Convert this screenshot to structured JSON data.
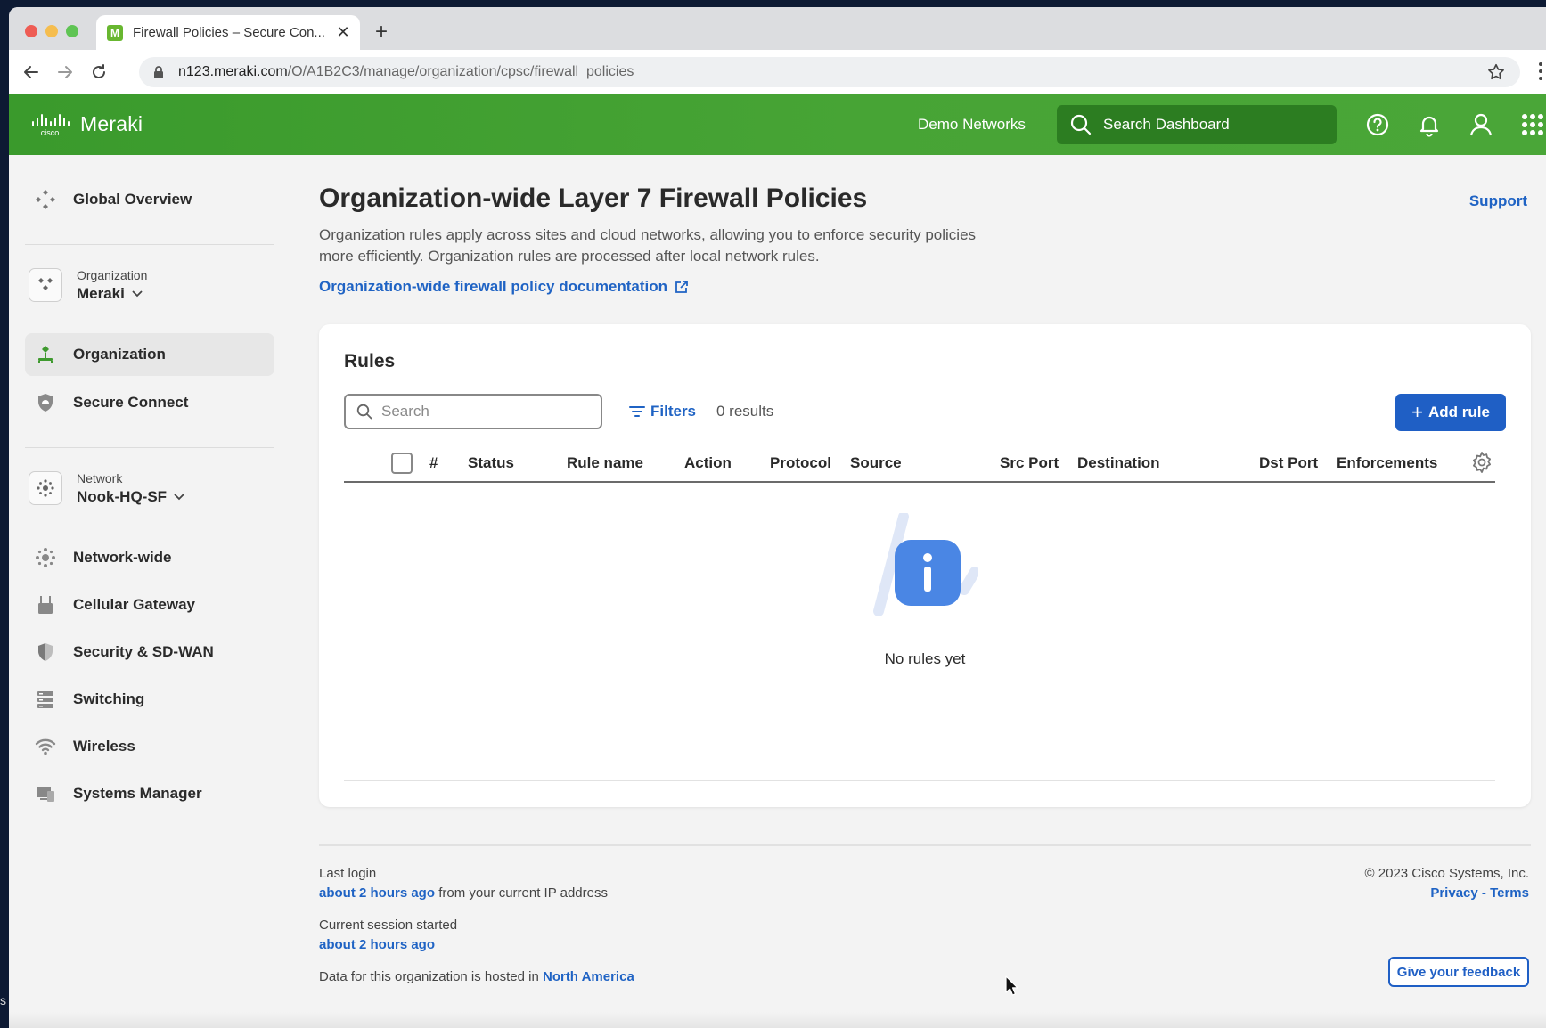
{
  "browser": {
    "tab_title": "Firewall Policies – Secure Con...",
    "favicon_letter": "M",
    "url_host": "n123.meraki.com",
    "url_path": "/O/A1B2C3/manage/organization/cpsc/firewall_policies"
  },
  "header": {
    "logo_text": "Meraki",
    "logo_small": "cisco",
    "demo_networks": "Demo Networks",
    "search_placeholder": "Search Dashboard",
    "brand_color": "#43a133"
  },
  "sidebar": {
    "global_overview": "Global Overview",
    "org_context": {
      "label": "Organization",
      "value": "Meraki"
    },
    "org_items": [
      {
        "label": "Organization",
        "icon": "organization-icon",
        "active": true
      },
      {
        "label": "Secure Connect",
        "icon": "shield-icon",
        "active": false
      }
    ],
    "network_context": {
      "label": "Network",
      "value": "Nook-HQ-SF"
    },
    "network_items": [
      {
        "label": "Network-wide",
        "icon": "network-wide-icon"
      },
      {
        "label": "Cellular Gateway",
        "icon": "cellular-gateway-icon"
      },
      {
        "label": "Security & SD-WAN",
        "icon": "security-sdwan-icon"
      },
      {
        "label": "Switching",
        "icon": "switching-icon"
      },
      {
        "label": "Wireless",
        "icon": "wifi-icon"
      },
      {
        "label": "Systems Manager",
        "icon": "systems-manager-icon"
      }
    ]
  },
  "main": {
    "title": "Organization-wide Layer 7 Firewall Policies",
    "support": "Support",
    "description": "Organization rules apply across sites and cloud networks, allowing you to enforce security policies more efficiently. Organization rules are processed after local network rules.",
    "doc_link": "Organization-wide firewall policy documentation",
    "rules": {
      "title": "Rules",
      "search_placeholder": "Search",
      "filters": "Filters",
      "results": "0 results",
      "add_rule": "Add rule",
      "columns": [
        "#",
        "Status",
        "Rule name",
        "Action",
        "Protocol",
        "Source",
        "Src Port",
        "Destination",
        "Dst Port",
        "Enforcements"
      ],
      "empty_text": "No rules yet"
    }
  },
  "footer": {
    "last_login_label": "Last login",
    "last_login_time": "about 2 hours ago",
    "last_login_suffix": "from your current IP address",
    "session_label": "Current session started",
    "session_time": "about 2 hours ago",
    "hosted_prefix": "Data for this organization is hosted in",
    "hosted_region": "North America",
    "copyright": "© 2023 Cisco Systems, Inc.",
    "privacy": "Privacy",
    "separator": "-",
    "terms": "Terms",
    "feedback": "Give your feedback"
  },
  "edge_text": "s"
}
